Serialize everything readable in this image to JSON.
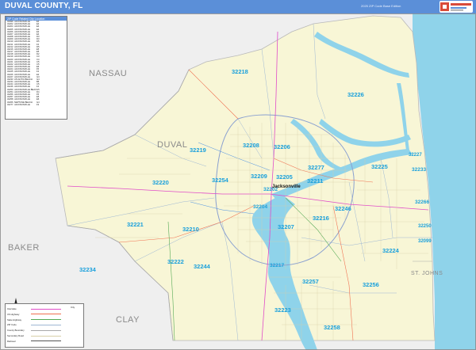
{
  "header": {
    "title": "DUVAL COUNTY, FL",
    "subtitle": "2025 ZIP Code Base Edition"
  },
  "colors": {
    "header": "#5b8fd8",
    "water": "#8fd3ea",
    "county_fill": "#f8f6d6",
    "outside": "#efefef",
    "zip_label": "#1aa0dc",
    "highway": "#e04cc8"
  },
  "legend": {
    "heading": "ZIP Code Related City Location",
    "rows": [
      {
        "zip": "32099",
        "city": "JACKSONVILLE",
        "grid": "E4"
      },
      {
        "zip": "32202",
        "city": "JACKSONVILLE",
        "grid": "E4"
      },
      {
        "zip": "32204",
        "city": "JACKSONVILLE",
        "grid": "E4"
      },
      {
        "zip": "32205",
        "city": "JACKSONVILLE",
        "grid": "E4"
      },
      {
        "zip": "32206",
        "city": "JACKSONVILLE",
        "grid": "E3"
      },
      {
        "zip": "32207",
        "city": "JACKSONVILLE",
        "grid": "E4"
      },
      {
        "zip": "32208",
        "city": "JACKSONVILLE",
        "grid": "D3"
      },
      {
        "zip": "32209",
        "city": "JACKSONVILLE",
        "grid": "D3"
      },
      {
        "zip": "32210",
        "city": "JACKSONVILLE",
        "grid": "D5"
      },
      {
        "zip": "32211",
        "city": "JACKSONVILLE",
        "grid": "F4"
      },
      {
        "zip": "32212",
        "city": "JACKSONVILLE",
        "grid": "D5"
      },
      {
        "zip": "32216",
        "city": "JACKSONVILLE",
        "grid": "E5"
      },
      {
        "zip": "32217",
        "city": "JACKSONVILLE",
        "grid": "E5"
      },
      {
        "zip": "32218",
        "city": "JACKSONVILLE",
        "grid": "D2"
      },
      {
        "zip": "32219",
        "city": "JACKSONVILLE",
        "grid": "C3"
      },
      {
        "zip": "32220",
        "city": "JACKSONVILLE",
        "grid": "C4"
      },
      {
        "zip": "32221",
        "city": "JACKSONVILLE",
        "grid": "C5"
      },
      {
        "zip": "32222",
        "city": "JACKSONVILLE",
        "grid": "C5"
      },
      {
        "zip": "32223",
        "city": "JACKSONVILLE",
        "grid": "E6"
      },
      {
        "zip": "32224",
        "city": "JACKSONVILLE",
        "grid": "F5"
      },
      {
        "zip": "32225",
        "city": "JACKSONVILLE",
        "grid": "F4"
      },
      {
        "zip": "32226",
        "city": "JACKSONVILLE",
        "grid": "E2"
      },
      {
        "zip": "32227",
        "city": "JACKSONVILLE",
        "grid": "G3"
      },
      {
        "zip": "32233",
        "city": "ATLANTIC BEACH",
        "grid": "G4"
      },
      {
        "zip": "32234",
        "city": "JACKSONVILLE",
        "grid": "B5"
      },
      {
        "zip": "32244",
        "city": "JACKSONVILLE",
        "grid": "C5"
      },
      {
        "zip": "32246",
        "city": "JACKSONVILLE",
        "grid": "F4"
      },
      {
        "zip": "32250",
        "city": "JACKSONVILLE BEACH",
        "grid": "G5"
      },
      {
        "zip": "32254",
        "city": "JACKSONVILLE",
        "grid": "D4"
      },
      {
        "zip": "32256",
        "city": "JACKSONVILLE",
        "grid": "F5"
      },
      {
        "zip": "32257",
        "city": "JACKSONVILLE",
        "grid": "E5"
      },
      {
        "zip": "32258",
        "city": "JACKSONVILLE",
        "grid": "E6"
      },
      {
        "zip": "32266",
        "city": "NEPTUNE BEACH",
        "grid": "G4"
      },
      {
        "zip": "32277",
        "city": "JACKSONVILLE",
        "grid": "F3"
      }
    ]
  },
  "counties": [
    {
      "name": "NASSAU"
    },
    {
      "name": "DUVAL"
    },
    {
      "name": "BAKER"
    },
    {
      "name": "CLAY"
    },
    {
      "name": "ST. JOHNS"
    }
  ],
  "zips": [
    "32218",
    "32226",
    "32219",
    "32208",
    "32206",
    "32277",
    "32225",
    "32227",
    "32233",
    "32220",
    "32254",
    "32209",
    "32205",
    "32202",
    "32211",
    "32204",
    "32246",
    "32266",
    "32250",
    "32221",
    "32210",
    "32207",
    "32216",
    "32224",
    "32222",
    "32244",
    "32217",
    "32234",
    "32257",
    "32256",
    "32223",
    "32258",
    "32099"
  ],
  "cities": [
    "Jacksonville"
  ],
  "key": {
    "city_label": "City",
    "rows": [
      "Interstate",
      "US Highway",
      "State Highway",
      "ZIP Code",
      "County Boundary",
      "Secondary Road",
      "Railroad"
    ]
  }
}
